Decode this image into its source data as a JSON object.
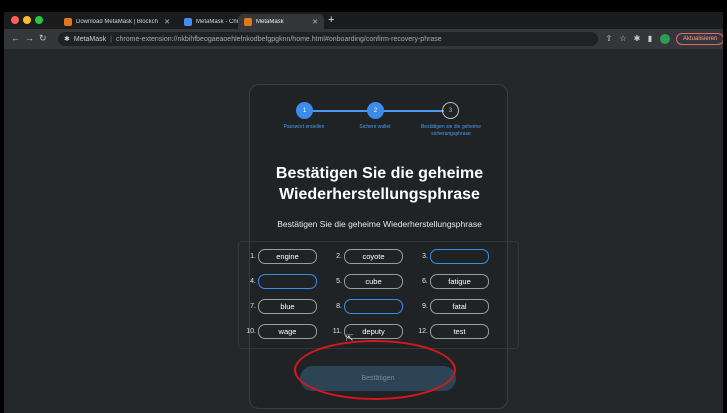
{
  "browser": {
    "window_buttons": {
      "close_color": "#ff5f57",
      "minimize_color": "#febc2e",
      "maximize_color": "#28c840"
    },
    "tabs": [
      {
        "title": "Download MetaMask | Blockch",
        "favicon": "metamask-fox-icon",
        "active": false
      },
      {
        "title": "MetaMask - Chrome Web Stor",
        "favicon": "chrome-web-store-icon",
        "active": false
      },
      {
        "title": "MetaMask",
        "favicon": "metamask-fox-icon",
        "active": true
      }
    ],
    "new_tab_label": "+",
    "address": {
      "site_name": "MetaMask",
      "separator": "|",
      "url": "chrome-extension://nkbihfbeogaeaoehlefnkodbefgpgknn/home.html#onboarding/confirm-recovery-phrase"
    },
    "update_button_label": "Aktualisieren"
  },
  "stepper": {
    "steps": [
      {
        "number": "1",
        "label": "Passwort erstellen",
        "state": "complete"
      },
      {
        "number": "2",
        "label": "Sichere wallet",
        "state": "complete"
      },
      {
        "number": "3",
        "label": "Bestätigen sie die geheime sicherungsphrase",
        "state": "pending"
      }
    ]
  },
  "main": {
    "title_line1": "Bestätigen Sie die geheime",
    "title_line2": "Wiederherstellungsphrase",
    "subtitle": "Bestätigen Sie die geheime Wiederherstellungsphrase",
    "confirm_button_label": "Bestätigen"
  },
  "recovery_words": [
    {
      "index": "1.",
      "word": "engine",
      "empty": false
    },
    {
      "index": "2.",
      "word": "coyote",
      "empty": false
    },
    {
      "index": "3.",
      "word": "",
      "empty": true
    },
    {
      "index": "4.",
      "word": "",
      "empty": true
    },
    {
      "index": "5.",
      "word": "cube",
      "empty": false
    },
    {
      "index": "6.",
      "word": "fatigue",
      "empty": false
    },
    {
      "index": "7.",
      "word": "blue",
      "empty": false
    },
    {
      "index": "8.",
      "word": "",
      "empty": true
    },
    {
      "index": "9.",
      "word": "fatal",
      "empty": false
    },
    {
      "index": "10.",
      "word": "wage",
      "empty": false
    },
    {
      "index": "11.",
      "word": "deputy",
      "empty": false
    },
    {
      "index": "12.",
      "word": "test",
      "empty": false
    }
  ],
  "colors": {
    "accent": "#3d8bea",
    "annotation_red": "#d4181c",
    "page_background": "#24272a",
    "card_background": "#1f2326"
  }
}
